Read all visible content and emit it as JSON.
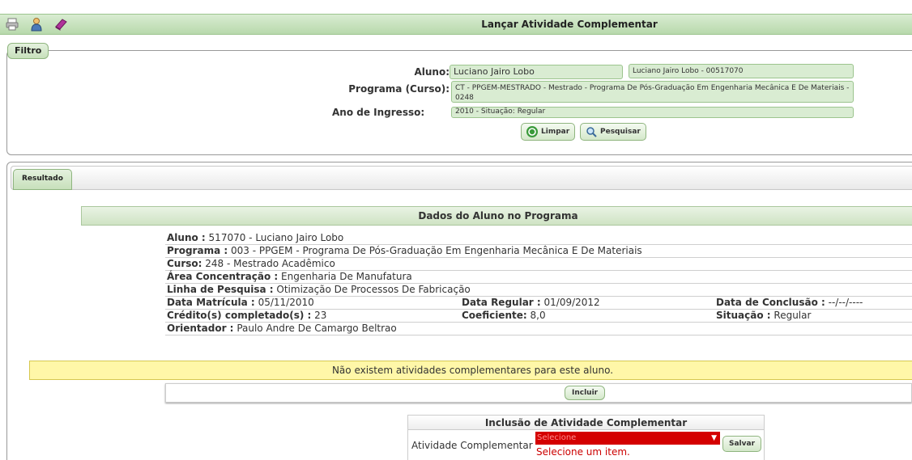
{
  "header": {
    "title": "Lançar Atividade Complementar",
    "icons": [
      "printer-icon",
      "user-icon",
      "book-icon"
    ]
  },
  "filtro": {
    "legend": "Filtro",
    "aluno_label": "Aluno:",
    "aluno_value": "Luciano Jairo Lobo",
    "aluno_suggestion": "Luciano Jairo Lobo - 00517070",
    "programa_label": "Programa (Curso):",
    "programa_value": "CT - PPGEM-MESTRADO - Mestrado - Programa De Pós-Graduação Em Engenharia Mecânica E De Materiais - 0248",
    "ano_label": "Ano de Ingresso:",
    "ano_value": "2010 - Situação: Regular",
    "limpar": "Limpar",
    "pesquisar": "Pesquisar"
  },
  "resultado": {
    "tab": "Resultado",
    "section_title": "Dados do Aluno no Programa",
    "aluno_label": "Aluno :",
    "aluno_value": "517070 - Luciano Jairo Lobo",
    "programa_label": "Programa :",
    "programa_value": "003 - PPGEM - Programa De Pós-Graduação Em Engenharia Mecânica E De Materiais",
    "curso_label": "Curso:",
    "curso_value": "248 - Mestrado Acadêmico",
    "area_label": "Área Concentração :",
    "area_value": "Engenharia De Manufatura",
    "linha_label": "Linha de Pesquisa :",
    "linha_value": "Otimização De Processos De Fabricação",
    "matricula_label": "Data Matrícula :",
    "matricula_value": "05/11/2010",
    "regular_label": "Data Regular :",
    "regular_value": "01/09/2012",
    "conclusao_label": "Data de Conclusão :",
    "conclusao_value": "--/--/----",
    "creditos_label": "Crédito(s) completado(s) :",
    "creditos_value": "23",
    "coeficiente_label": "Coeficiente:",
    "coeficiente_value": "8,0",
    "situacao_label": "Situação :",
    "situacao_value": "Regular",
    "orientador_label": "Orientador :",
    "orientador_value": "Paulo Andre De Camargo Beltrao",
    "warning": "Não existem atividades complementares para este aluno.",
    "incluir": "Incluir"
  },
  "inclusao": {
    "title": "Inclusão de Atividade Complementar",
    "label": "Atividade Complementar",
    "select_value": "Selecione",
    "error": "Selecione um item.",
    "salvar": "Salvar"
  }
}
